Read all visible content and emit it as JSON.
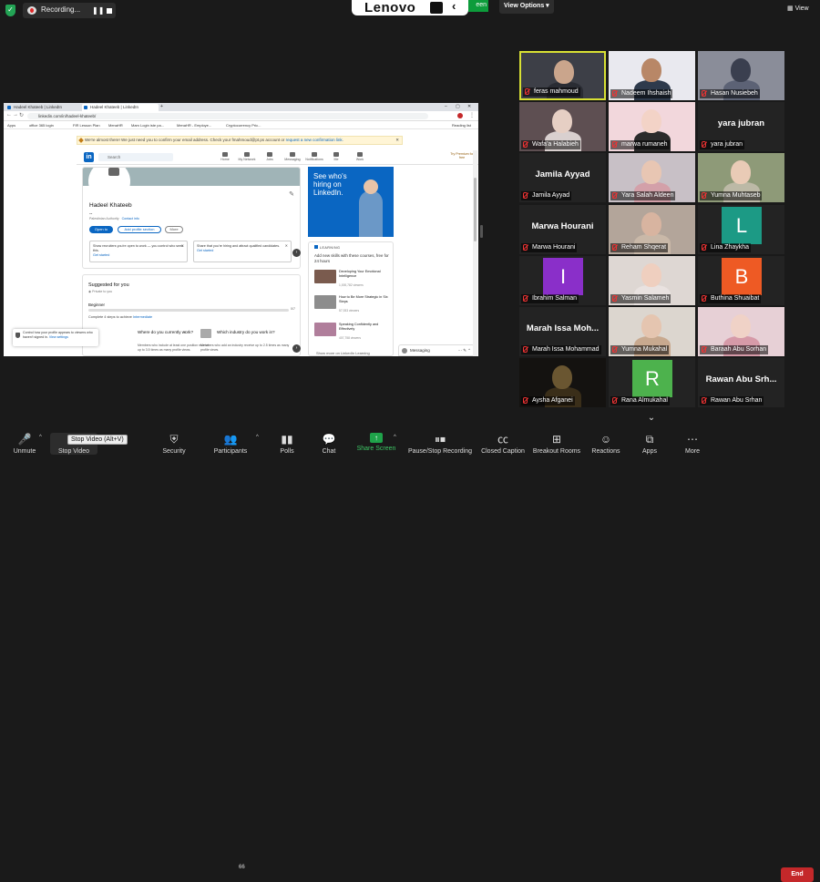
{
  "topbar": {
    "recording_label": "Recording...",
    "pause_icon": "pause-icon",
    "lenovo_brand": "Lenovo",
    "share_label": "een",
    "view_options": "View Options",
    "view_button": "View"
  },
  "shared_screen": {
    "tabs": [
      "Hadeel Khateeb | LinkedIn",
      "Hadeel Khateeb | LinkedIn"
    ],
    "url": "linkedin.com/in/hadeel-khateeb/",
    "bookmarks": [
      "Apps",
      "office 365 login",
      "FIR Lesson Plan",
      "MenaHR",
      "Mam Login iste pa...",
      "MenaHR - Employe...",
      "Cryptocurrency Pric..."
    ],
    "reading_list": "Reading list",
    "notice_text": "We're almost there! We just need you to confirm your email address. Check your fmahmoud@pt.ps account or",
    "notice_link": "request a new confirmation link.",
    "search_placeholder": "Search",
    "nav_items": [
      "Home",
      "My Network",
      "Jobs",
      "Messaging",
      "Notifications",
      "Me",
      "Work"
    ],
    "premium_text": "Try Premium for free",
    "profile": {
      "name": "Hadeel Khateeb",
      "dash": "--",
      "location": "Palestinian Authority",
      "contact": "Contact info",
      "open_to": "Open to",
      "add_section": "Add profile section",
      "more": "More"
    },
    "cards": [
      {
        "text": "Show recruiters you're open to work — you control who sees this.",
        "link": "Get started"
      },
      {
        "text": "Share that you're hiring and attract qualified candidates.",
        "link": "Get started"
      }
    ],
    "suggested": {
      "title": "Suggested for you",
      "private": "Private to you",
      "level": "Beginner",
      "count": "0/7",
      "progress": 0,
      "desc": "Complete 4 steps to achieve",
      "desc_link": "Intermediate",
      "work_q": "Where do you currently work?",
      "work_d": "Members who include at least one position receive up to 3.5 times as many profile views.",
      "industry_q": "Which industry do you work in?",
      "industry_d": "Members who add an industry receive up to 2.5 times as many profile views."
    },
    "toast": {
      "text": "Control how your profile appears to viewers who haven't signed in.",
      "link": "View settings"
    },
    "ad_text": "See who's hiring on LinkedIn.",
    "learning": {
      "header": "LEARNING",
      "subtitle": "Add new skills with these courses, free for 24 hours",
      "courses": [
        {
          "title": "Developing Your Emotional Intelligence",
          "views": "1,000,782 viewers"
        },
        {
          "title": "How to Be More Strategic in Six Steps",
          "views": "57,933 viewers"
        },
        {
          "title": "Speaking Confidently and Effectively",
          "views": "407,758 viewers"
        }
      ],
      "show_more": "Show more on LinkedIn Learning"
    },
    "messaging": "Messaging"
  },
  "participants": [
    {
      "name": "feras mahmoud",
      "kind": "video",
      "active": true,
      "bg": "#3d3f47",
      "face": "#caa58c",
      "body": "#2a2c33"
    },
    {
      "name": "Nadeem Ihshaish",
      "kind": "video",
      "bg": "#e9e9ef",
      "face": "#b88767",
      "body": "#2e3a4c"
    },
    {
      "name": "Hasan Nusiebeh",
      "kind": "video",
      "bg": "#8a8d99",
      "face": "#3a3f4f",
      "body": "#5c6275"
    },
    {
      "name": "Wafa'a Halabieh",
      "kind": "video",
      "bg": "#5e4f52",
      "face": "#e6cfc4",
      "body": "#d9d0cf"
    },
    {
      "name": "marwa rumaneh",
      "kind": "video",
      "bg": "#f2d7dc",
      "face": "#f3d3c7",
      "body": "#2b2b2b"
    },
    {
      "name": "yara jubran",
      "kind": "name",
      "display": "yara jubran"
    },
    {
      "name": "Jamila Ayyad",
      "kind": "name",
      "display": "Jamila Ayyad"
    },
    {
      "name": "Yara Salah  Aldeen",
      "kind": "video",
      "bg": "#c8c0c6",
      "face": "#e8c6b3",
      "body": "#d3a0a9"
    },
    {
      "name": "Yumna Muhtaseb",
      "kind": "video",
      "bg": "#8e9a78",
      "face": "#e9cbb6",
      "body": "#bcb9a6"
    },
    {
      "name": "Marwa Hourani",
      "kind": "name",
      "display": "Marwa Hourani"
    },
    {
      "name": "Reham Shqerat",
      "kind": "video",
      "bg": "#b3a59a",
      "face": "#d8b4a0",
      "body": "#c9b8a8"
    },
    {
      "name": "Lina Zhaykha",
      "kind": "letter",
      "letter": "L",
      "color": "#1c9a85"
    },
    {
      "name": "Ibrahim Salman",
      "kind": "letter",
      "letter": "I",
      "color": "#8a2fc9"
    },
    {
      "name": "Yasmin Salameh",
      "kind": "video",
      "bg": "#ded7d3",
      "face": "#efcfbf",
      "body": "#e9e2e0"
    },
    {
      "name": "Buthina Shuaibat",
      "kind": "letter",
      "letter": "B",
      "color": "#ee5a24"
    },
    {
      "name": "Marah Issa Mohammad",
      "kind": "name",
      "display": "Marah Issa Moh..."
    },
    {
      "name": "Yumna Mukahal",
      "kind": "video",
      "bg": "#dcd6cf",
      "face": "#e5c5b0",
      "body": "#c8a98f"
    },
    {
      "name": "Baraah Abu Sorhan",
      "kind": "video",
      "bg": "#e7d0d6",
      "face": "#f0d2c7",
      "body": "#d69aa8"
    },
    {
      "name": "Aysha Afganei",
      "kind": "video",
      "bg": "#141210",
      "face": "#6a5631",
      "body": "#3a2e19"
    },
    {
      "name": "Rana Almukahal",
      "kind": "letter",
      "letter": "R",
      "color": "#4db24d"
    },
    {
      "name": "Rawan  Abu Srhan",
      "kind": "name",
      "display": "Rawan   Abu Srh..."
    }
  ],
  "toolbar": {
    "unmute": "Unmute",
    "stop_video": "Stop Video",
    "security": "Security",
    "participants": "Participants",
    "participant_count": "66",
    "polls": "Polls",
    "chat": "Chat",
    "share_screen": "Share Screen",
    "record": "Pause/Stop Recording",
    "cc": "Closed Caption",
    "breakout": "Breakout Rooms",
    "reactions": "Reactions",
    "apps": "Apps",
    "more": "More",
    "end": "End",
    "tooltip": "Stop Video (Alt+V)"
  },
  "colors": {
    "share_green": "#0d9c3b",
    "end_red": "#c4282a",
    "active_border": "#d8e034",
    "linkedin_blue": "#0a66c2"
  }
}
